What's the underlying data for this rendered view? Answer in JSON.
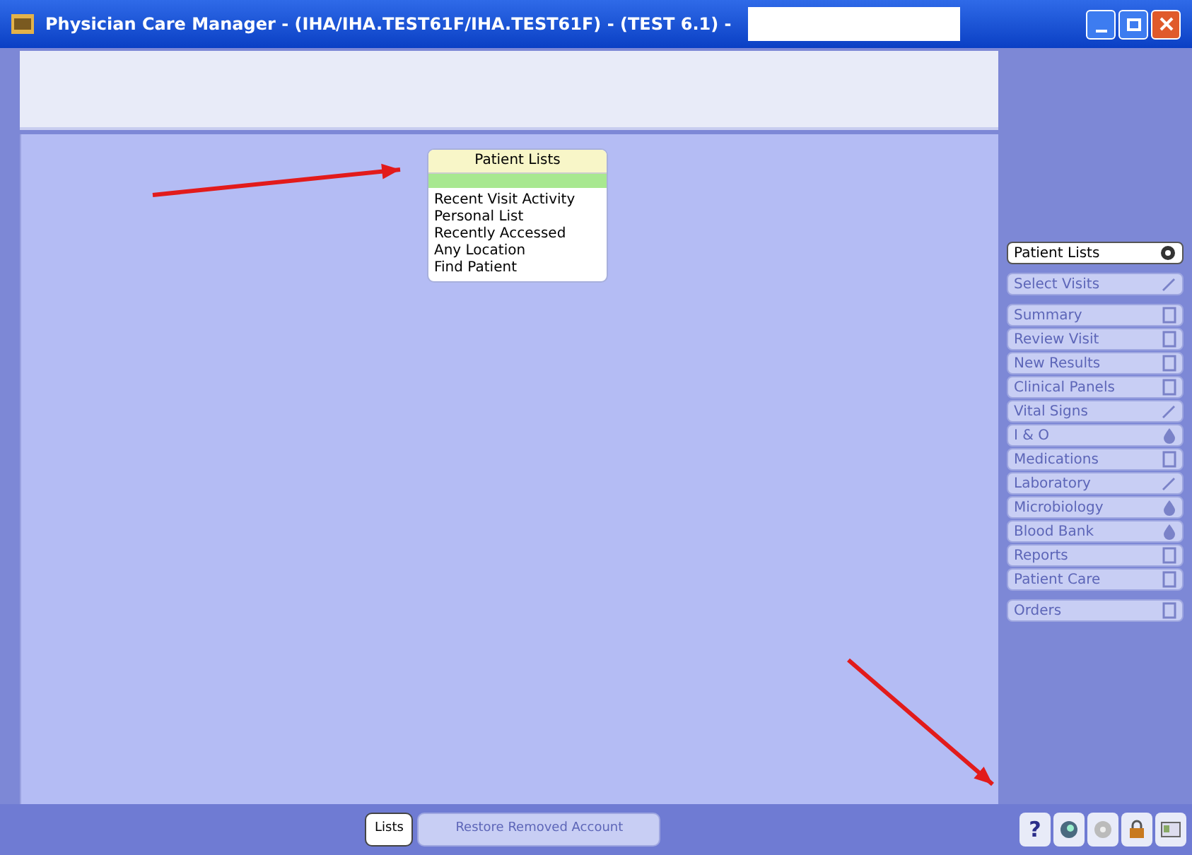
{
  "window": {
    "title": "Physician Care Manager -  (IHA/IHA.TEST61F/IHA.TEST61F) - (TEST 6.1) -"
  },
  "popup": {
    "title": "Patient Lists",
    "items": [
      {
        "label": "Recent Visit Activity"
      },
      {
        "label": "Personal List"
      },
      {
        "label": "Recently Accessed"
      },
      {
        "label": "Any Location"
      },
      {
        "label": "Find Patient"
      }
    ]
  },
  "sidebar": {
    "groups": [
      {
        "items": [
          {
            "label": "Patient Lists",
            "disabled": false,
            "kind": "refresh"
          }
        ]
      },
      {
        "items": [
          {
            "label": "Select Visits",
            "disabled": true,
            "kind": "pen"
          }
        ]
      },
      {
        "items": [
          {
            "label": "Summary",
            "disabled": true,
            "kind": "doc"
          },
          {
            "label": "Review Visit",
            "disabled": true,
            "kind": "doc"
          },
          {
            "label": "New Results",
            "disabled": true,
            "kind": "doc"
          },
          {
            "label": "Clinical Panels",
            "disabled": true,
            "kind": "doc"
          },
          {
            "label": "Vital Signs",
            "disabled": true,
            "kind": "pen"
          },
          {
            "label": "I & O",
            "disabled": true,
            "kind": "drop"
          },
          {
            "label": "Medications",
            "disabled": true,
            "kind": "doc"
          },
          {
            "label": "Laboratory",
            "disabled": true,
            "kind": "pen"
          },
          {
            "label": "Microbiology",
            "disabled": true,
            "kind": "drop"
          },
          {
            "label": "Blood Bank",
            "disabled": true,
            "kind": "drop"
          },
          {
            "label": "Reports",
            "disabled": true,
            "kind": "doc"
          },
          {
            "label": "Patient Care",
            "disabled": true,
            "kind": "doc"
          }
        ]
      },
      {
        "items": [
          {
            "label": "Orders",
            "disabled": true,
            "kind": "doc"
          }
        ]
      }
    ]
  },
  "bottom_bar": {
    "buttons": [
      {
        "label": "Lists",
        "disabled": false
      },
      {
        "label": "Restore Removed Account",
        "disabled": true
      }
    ],
    "help": "?"
  }
}
